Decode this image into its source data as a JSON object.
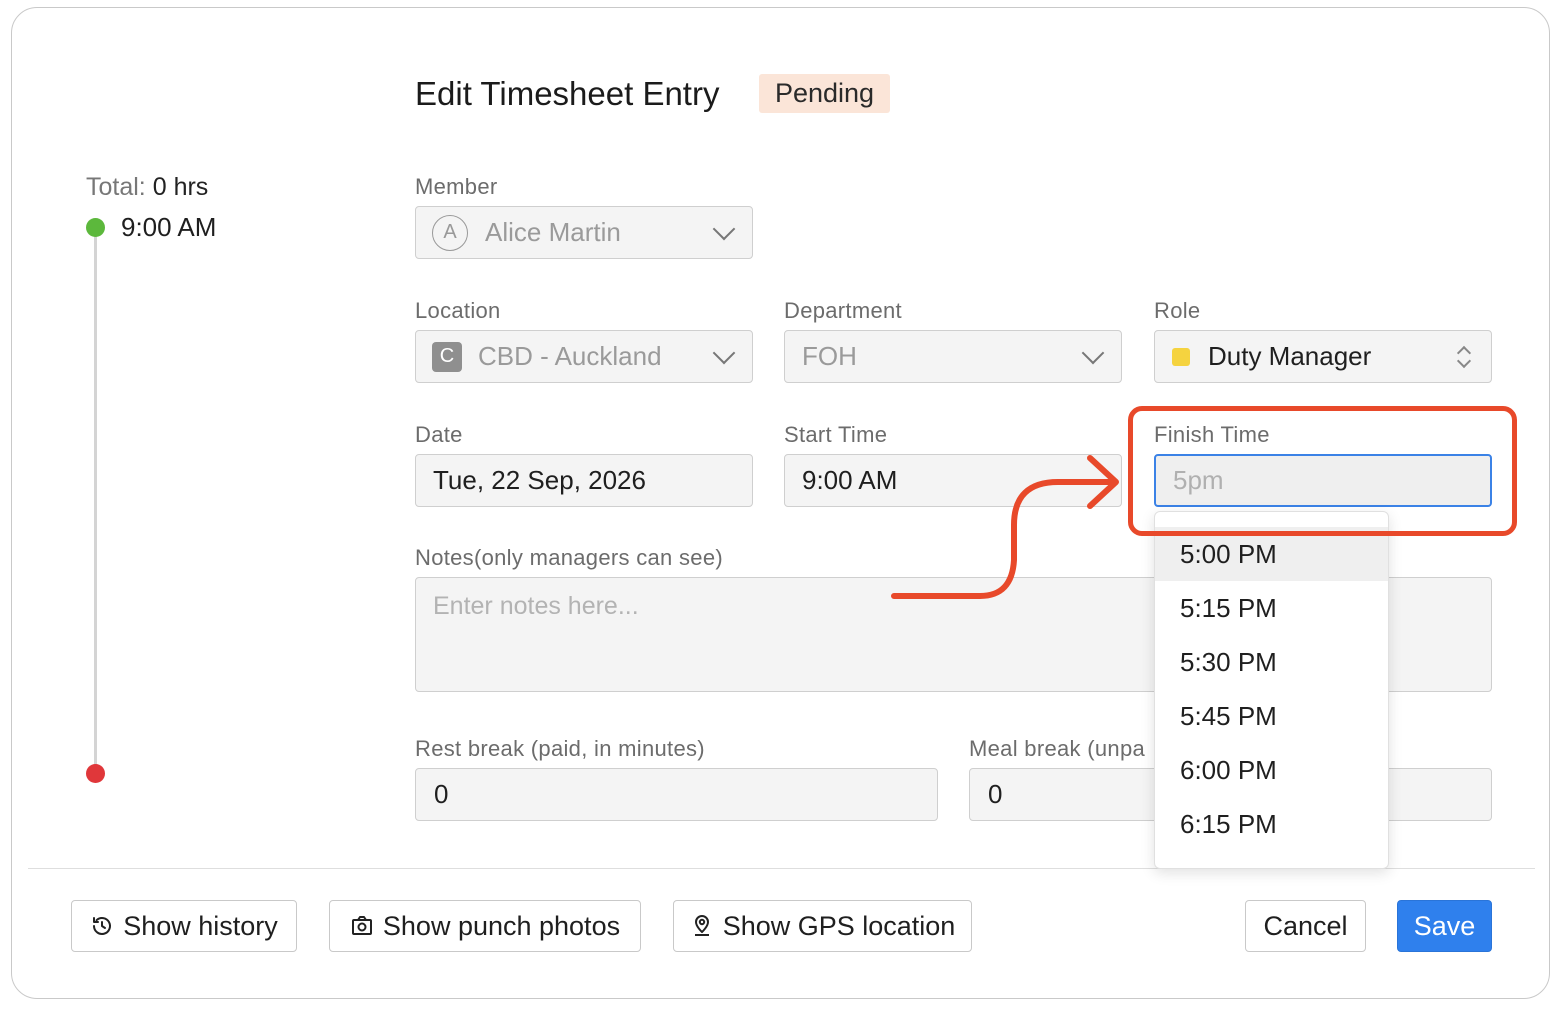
{
  "header": {
    "title": "Edit Timesheet Entry",
    "status": "Pending"
  },
  "timeline": {
    "total_label": "Total:",
    "total_value": "0 hrs",
    "start_time": "9:00 AM",
    "colors": {
      "start": "#5cb83c",
      "end": "#e0373a"
    }
  },
  "form": {
    "member": {
      "label": "Member",
      "avatar_initial": "A",
      "value": "Alice Martin"
    },
    "location": {
      "label": "Location",
      "icon_letter": "C",
      "value": "CBD - Auckland"
    },
    "department": {
      "label": "Department",
      "value": "FOH"
    },
    "role": {
      "label": "Role",
      "value": "Duty Manager",
      "color": "#f5d33f"
    },
    "date": {
      "label": "Date",
      "value": "Tue, 22 Sep, 2026"
    },
    "start_time": {
      "label": "Start Time",
      "value": "9:00 AM"
    },
    "finish_time": {
      "label": "Finish Time",
      "placeholder": "5pm"
    },
    "notes": {
      "label": "Notes(only managers can see)",
      "placeholder": "Enter notes here..."
    },
    "rest_break": {
      "label": "Rest break (paid, in minutes)",
      "value": "0"
    },
    "meal_break": {
      "label": "Meal break (unpa",
      "value": "0"
    }
  },
  "finish_time_menu": {
    "options": [
      "5:00 PM",
      "5:15 PM",
      "5:30 PM",
      "5:45 PM",
      "6:00 PM",
      "6:15 PM"
    ],
    "highlighted_index": 0
  },
  "footer": {
    "show_history": "Show history",
    "show_punch_photos": "Show punch photos",
    "show_gps_location": "Show GPS location",
    "cancel": "Cancel",
    "save": "Save"
  },
  "annotation": {
    "color": "#e8492a"
  }
}
